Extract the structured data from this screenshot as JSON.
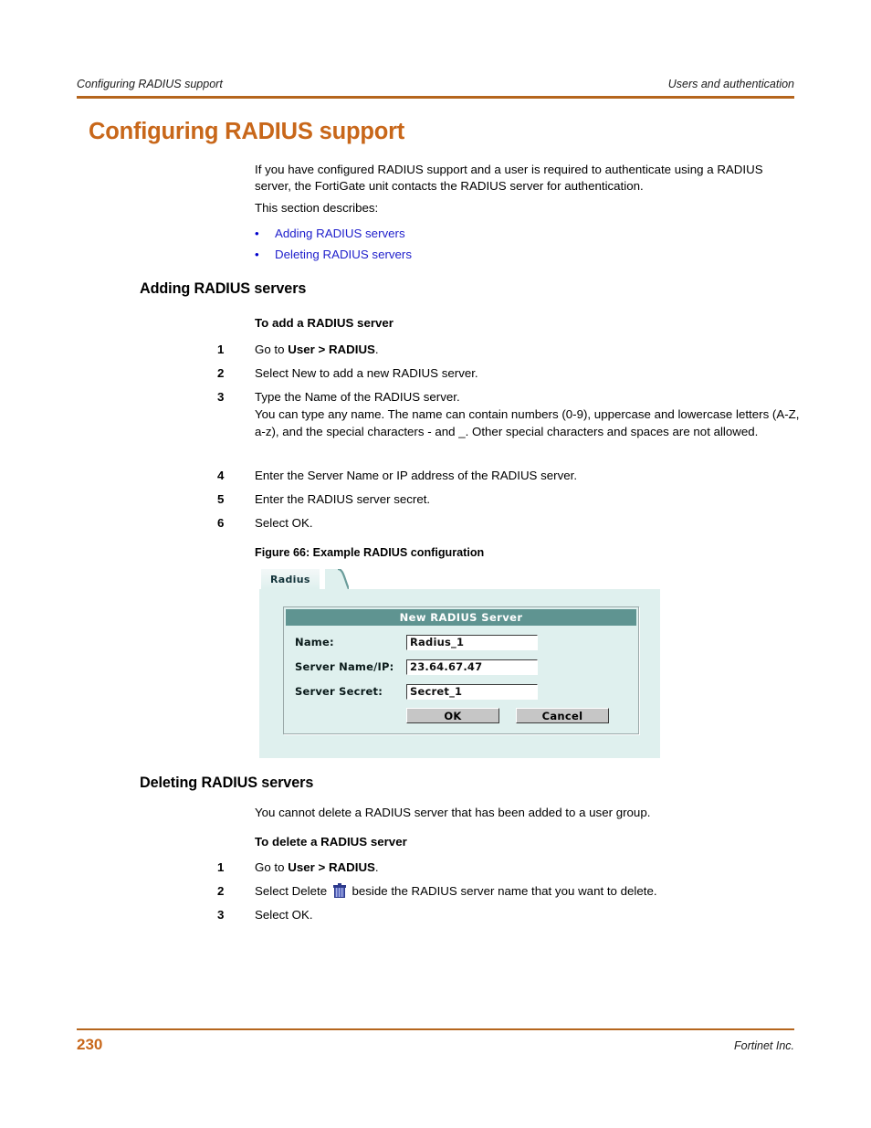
{
  "header": {
    "left": "Configuring RADIUS support",
    "right": "Users and authentication",
    "rule_color": "#b5651d"
  },
  "title": "Configuring RADIUS support",
  "title_color": "#c8671a",
  "intro": {
    "paragraph": "If you have configured RADIUS support and a user is required to authenticate using a RADIUS server, the FortiGate unit contacts the RADIUS server for authentication.",
    "section_lead": "This section describes:",
    "links": [
      {
        "bullet": "•",
        "label": "Adding RADIUS servers"
      },
      {
        "bullet": "•",
        "label": "Deleting RADIUS servers"
      }
    ],
    "link_color": "#2020cc"
  },
  "adding": {
    "heading": "Adding RADIUS servers",
    "procedure_title": "To add a RADIUS server",
    "steps": [
      {
        "num": "1",
        "pre": "Go to ",
        "bold": "User > RADIUS",
        "post": "."
      },
      {
        "num": "2",
        "pre": "Select New to add a new RADIUS server.",
        "bold": "",
        "post": ""
      },
      {
        "num": "3",
        "pre": "Type the Name of the RADIUS server.",
        "bold": "",
        "post": ""
      },
      {
        "num": "4",
        "pre": "Enter the Server Name or IP address of the RADIUS server.",
        "bold": "",
        "post": ""
      },
      {
        "num": "5",
        "pre": "Enter the RADIUS server secret.",
        "bold": "",
        "post": ""
      },
      {
        "num": "6",
        "pre": "Select OK.",
        "bold": "",
        "post": ""
      }
    ],
    "step3_detail": "You can type any name. The name can contain numbers (0-9), uppercase and lowercase letters (A-Z, a-z), and the special characters - and _. Other special characters and spaces are not allowed."
  },
  "figure": {
    "caption": "Figure 66: Example RADIUS configuration",
    "tab_label": "Radius",
    "panel_title": "New RADIUS Server",
    "fields": [
      {
        "label": "Name:",
        "value": "Radius_1"
      },
      {
        "label": "Server Name/IP:",
        "value": "23.64.67.47"
      },
      {
        "label": "Server Secret:",
        "value": "Secret_1"
      }
    ],
    "buttons": [
      {
        "label": "OK"
      },
      {
        "label": "Cancel"
      }
    ],
    "colors": {
      "background": "#dff0ee",
      "title_bar": "#5f9491",
      "button_face": "#c6c6c6"
    }
  },
  "deleting": {
    "heading": "Deleting RADIUS servers",
    "note": "You cannot delete a RADIUS server that has been added to a user group.",
    "procedure_title": "To delete a RADIUS server",
    "steps": [
      {
        "num": "1",
        "pre": "Go to ",
        "bold": "User > RADIUS",
        "post": "."
      },
      {
        "num": "2",
        "pre": "Select Delete ",
        "icon": "trash-icon",
        "post": " beside the RADIUS server name that you want to delete."
      },
      {
        "num": "3",
        "pre": "Select OK.",
        "post": ""
      }
    ]
  },
  "footer": {
    "page_number": "230",
    "company": "Fortinet Inc.",
    "color": "#c8671a"
  }
}
